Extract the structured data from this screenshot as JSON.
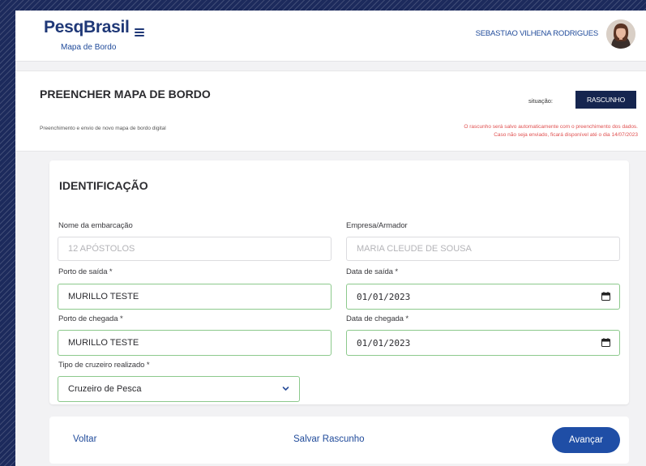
{
  "header": {
    "brand": "PesqBrasil",
    "brand_sub": "Mapa de Bordo",
    "user_name": "SEBASTIAO VILHENA RODRIGUES"
  },
  "page": {
    "title": "PREENCHER MAPA DE BORDO",
    "subtitle": "Preenchimento e envio de novo mapa de bordo digital",
    "situacao_label": "situação:",
    "situacao_value": "RASCUNHO",
    "draft_note_line1": "O rascunho será salvo automaticamente com o preenchimento dos dados.",
    "draft_note_line2": "Caso não seja enviado, ficará disponível até o dia 14/07/2023"
  },
  "identificacao": {
    "title": "IDENTIFICAÇÃO",
    "nome_embarcacao": {
      "label": "Nome da embarcação",
      "value": "12 APÓSTOLOS"
    },
    "empresa_armador": {
      "label": "Empresa/Armador",
      "value": "MARIA CLEUDE DE SOUSA"
    },
    "porto_saida": {
      "label": "Porto de saída *",
      "value": "MURILLO TESTE"
    },
    "data_saida": {
      "label": "Data de saída *",
      "value": "01/01/2023"
    },
    "porto_chegada": {
      "label": "Porto de chegada *",
      "value": "MURILLO TESTE"
    },
    "data_chegada": {
      "label": "Data de chegada *",
      "value": "01/01/2023"
    },
    "tipo_cruzeiro": {
      "label": "Tipo de cruzeiro realizado *",
      "value": "Cruzeiro de Pesca"
    }
  },
  "actions": {
    "voltar": "Voltar",
    "salvar": "Salvar Rascunho",
    "avancar": "Avançar"
  },
  "colors": {
    "primary": "#1f4ea6",
    "brand": "#1f3877",
    "badge": "#15254f",
    "valid_border": "#8cc98c",
    "warning_text": "#e05050"
  }
}
